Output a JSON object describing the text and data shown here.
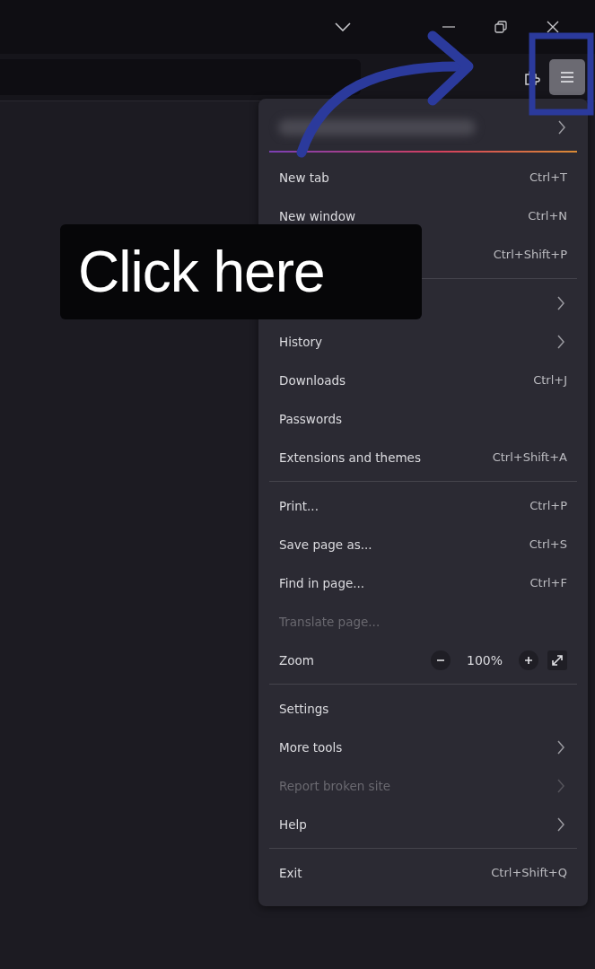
{
  "menu_button": {
    "active": true
  },
  "menu": {
    "sections": [
      [
        {
          "kind": "item",
          "label": "New tab",
          "shortcut": "Ctrl+T",
          "disabled": false
        },
        {
          "kind": "item",
          "label": "New window",
          "shortcut": "Ctrl+N",
          "disabled": false
        },
        {
          "kind": "item",
          "shortcut": "Ctrl+Shift+P",
          "disabled": false
        }
      ],
      [
        {
          "kind": "submenu",
          "disabled": false
        },
        {
          "kind": "submenu",
          "label": "History",
          "disabled": false
        },
        {
          "kind": "item",
          "label": "Downloads",
          "shortcut": "Ctrl+J",
          "disabled": false
        },
        {
          "kind": "item",
          "label": "Passwords",
          "disabled": false
        },
        {
          "kind": "item",
          "label": "Extensions and themes",
          "shortcut": "Ctrl+Shift+A",
          "disabled": false
        }
      ],
      [
        {
          "kind": "item",
          "label": "Print...",
          "shortcut": "Ctrl+P",
          "disabled": false
        },
        {
          "kind": "item",
          "label": "Save page as...",
          "shortcut": "Ctrl+S",
          "disabled": false
        },
        {
          "kind": "item",
          "label": "Find in page...",
          "shortcut": "Ctrl+F",
          "disabled": false
        },
        {
          "kind": "item",
          "label": "Translate page...",
          "disabled": true
        },
        {
          "kind": "zoom",
          "label": "Zoom",
          "value": "100%",
          "disabled": false
        }
      ],
      [
        {
          "kind": "item",
          "label": "Settings",
          "disabled": false
        },
        {
          "kind": "submenu",
          "label": "More tools",
          "disabled": false
        },
        {
          "kind": "submenu",
          "label": "Report broken site",
          "disabled": true
        },
        {
          "kind": "submenu",
          "label": "Help",
          "disabled": false
        }
      ],
      [
        {
          "kind": "item",
          "label": "Exit",
          "shortcut": "Ctrl+Shift+Q",
          "disabled": false
        }
      ]
    ]
  },
  "annotation": {
    "label": "Click here"
  }
}
